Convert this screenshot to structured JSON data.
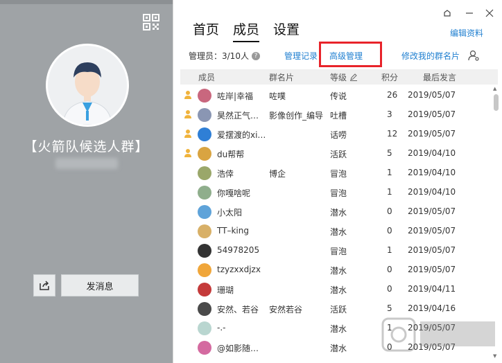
{
  "profile": {
    "group_name": "【火箭队候选人群】",
    "send_label": "发消息"
  },
  "tabs": [
    {
      "label": "首页"
    },
    {
      "label": "成员"
    },
    {
      "label": "设置"
    }
  ],
  "header": {
    "edit_info": "编辑资料",
    "admin_count": "管理员：3/10人",
    "admin_log": "管理记录",
    "advanced_manage": "高级管理",
    "edit_my_card": "修改我的群名片"
  },
  "table": {
    "columns": [
      "成员",
      "群名片",
      "等级",
      "积分",
      "最后发言"
    ],
    "rows": [
      {
        "name": "咗岸|幸福",
        "card": "咗噗",
        "level": "传说",
        "points": "26",
        "date": "2019/05/07",
        "admin": true,
        "avatar_color": "#c9677e"
      },
      {
        "name": "昊然正气…",
        "card": "影像创作_编导",
        "level": "吐槽",
        "points": "3",
        "date": "2019/05/07",
        "admin": true,
        "avatar_color": "#8a96b3"
      },
      {
        "name": "爱摆渡的xi…",
        "card": "",
        "level": "话唠",
        "points": "12",
        "date": "2019/05/07",
        "admin": true,
        "avatar_color": "#2f7fd6"
      },
      {
        "name": "du帮帮",
        "card": "",
        "level": "活跃",
        "points": "5",
        "date": "2019/04/10",
        "admin": true,
        "avatar_color": "#d9a441"
      },
      {
        "name": "浩倖",
        "card": "博企",
        "level": "冒泡",
        "points": "1",
        "date": "2019/04/10",
        "admin": false,
        "avatar_color": "#9aa76a"
      },
      {
        "name": "你嘎啥呢",
        "card": "",
        "level": "冒泡",
        "points": "1",
        "date": "2019/04/10",
        "admin": false,
        "avatar_color": "#8fae8c"
      },
      {
        "name": "小太阳",
        "card": "",
        "level": "潜水",
        "points": "0",
        "date": "2019/05/07",
        "admin": false,
        "avatar_color": "#5fa3d9"
      },
      {
        "name": "TT–king",
        "card": "",
        "level": "潜水",
        "points": "0",
        "date": "2019/05/07",
        "admin": false,
        "avatar_color": "#d8b067"
      },
      {
        "name": "54978205",
        "card": "",
        "level": "冒泡",
        "points": "1",
        "date": "2019/05/07",
        "admin": false,
        "avatar_color": "#333333"
      },
      {
        "name": "tzyzxxdjzx",
        "card": "",
        "level": "潜水",
        "points": "0",
        "date": "2019/05/07",
        "admin": false,
        "avatar_color": "#f0a63a"
      },
      {
        "name": "珊瑚",
        "card": "",
        "level": "潜水",
        "points": "0",
        "date": "2019/04/11",
        "admin": false,
        "avatar_color": "#c43a3a"
      },
      {
        "name": "安然、若谷",
        "card": "安然若谷",
        "level": "活跃",
        "points": "5",
        "date": "2019/04/16",
        "admin": false,
        "avatar_color": "#4a4a4a"
      },
      {
        "name": "-.-",
        "card": "",
        "level": "潜水",
        "points": "1",
        "date": "2019/05/07",
        "admin": false,
        "avatar_color": "#b9d6d0"
      },
      {
        "name": "@如影随…",
        "card": "",
        "level": "潜水",
        "points": "0",
        "date": "2019/05/07",
        "admin": false,
        "avatar_color": "#d46aa0"
      }
    ]
  },
  "colors": {
    "left_panel": "#9fa3a6",
    "link": "#1f7fd0",
    "highlight_border": "#e8232a"
  },
  "icons": [
    "qr-code-icon",
    "share-icon",
    "skin-icon",
    "minimize-icon",
    "close-icon",
    "help-icon",
    "member-settings-icon",
    "edit-pencil-icon",
    "admin-icon"
  ]
}
